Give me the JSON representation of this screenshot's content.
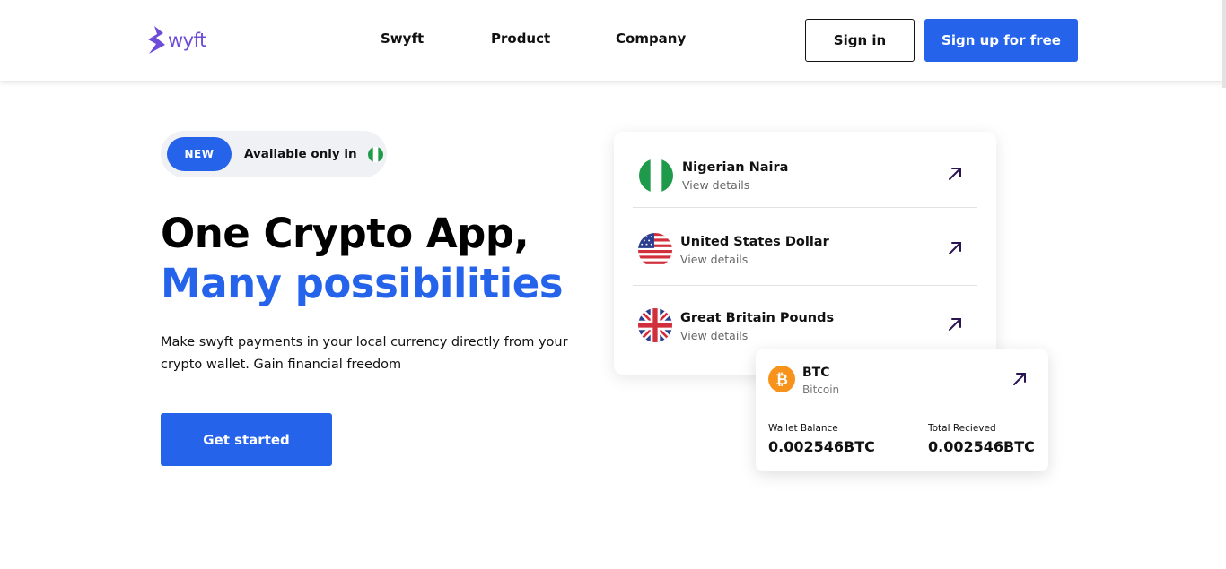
{
  "header": {
    "logo_text": "wyft",
    "nav": [
      "Swyft",
      "Product",
      "Company"
    ],
    "signin_label": "Sign in",
    "signup_label": "Sign up for free"
  },
  "hero": {
    "badge": "NEW",
    "availability": "Available only in",
    "title_line1": "One Crypto App,",
    "title_line2": "Many possibilities",
    "subtitle": "Make swyft payments in your local currency directly from your crypto wallet. Gain financial freedom",
    "cta_label": "Get started"
  },
  "currencies": [
    {
      "name": "Nigerian Naira",
      "details": "View details",
      "flag": "nigeria-flag-icon"
    },
    {
      "name": "United States Dollar",
      "details": "View details",
      "flag": "usa-flag-icon"
    },
    {
      "name": "Great Britain Pounds",
      "details": "View details",
      "flag": "uk-flag-icon"
    }
  ],
  "btc": {
    "ticker": "BTC",
    "name": "Bitcoin",
    "wallet_label": "Wallet Balance",
    "wallet_value": "0.002546BTC",
    "received_label": "Total Recieved",
    "received_value": "0.002546BTC"
  },
  "colors": {
    "accent": "#2563eb",
    "logo": "#6c4cd8",
    "arrow": "#2a1452",
    "bitcoin": "#f7931a"
  }
}
